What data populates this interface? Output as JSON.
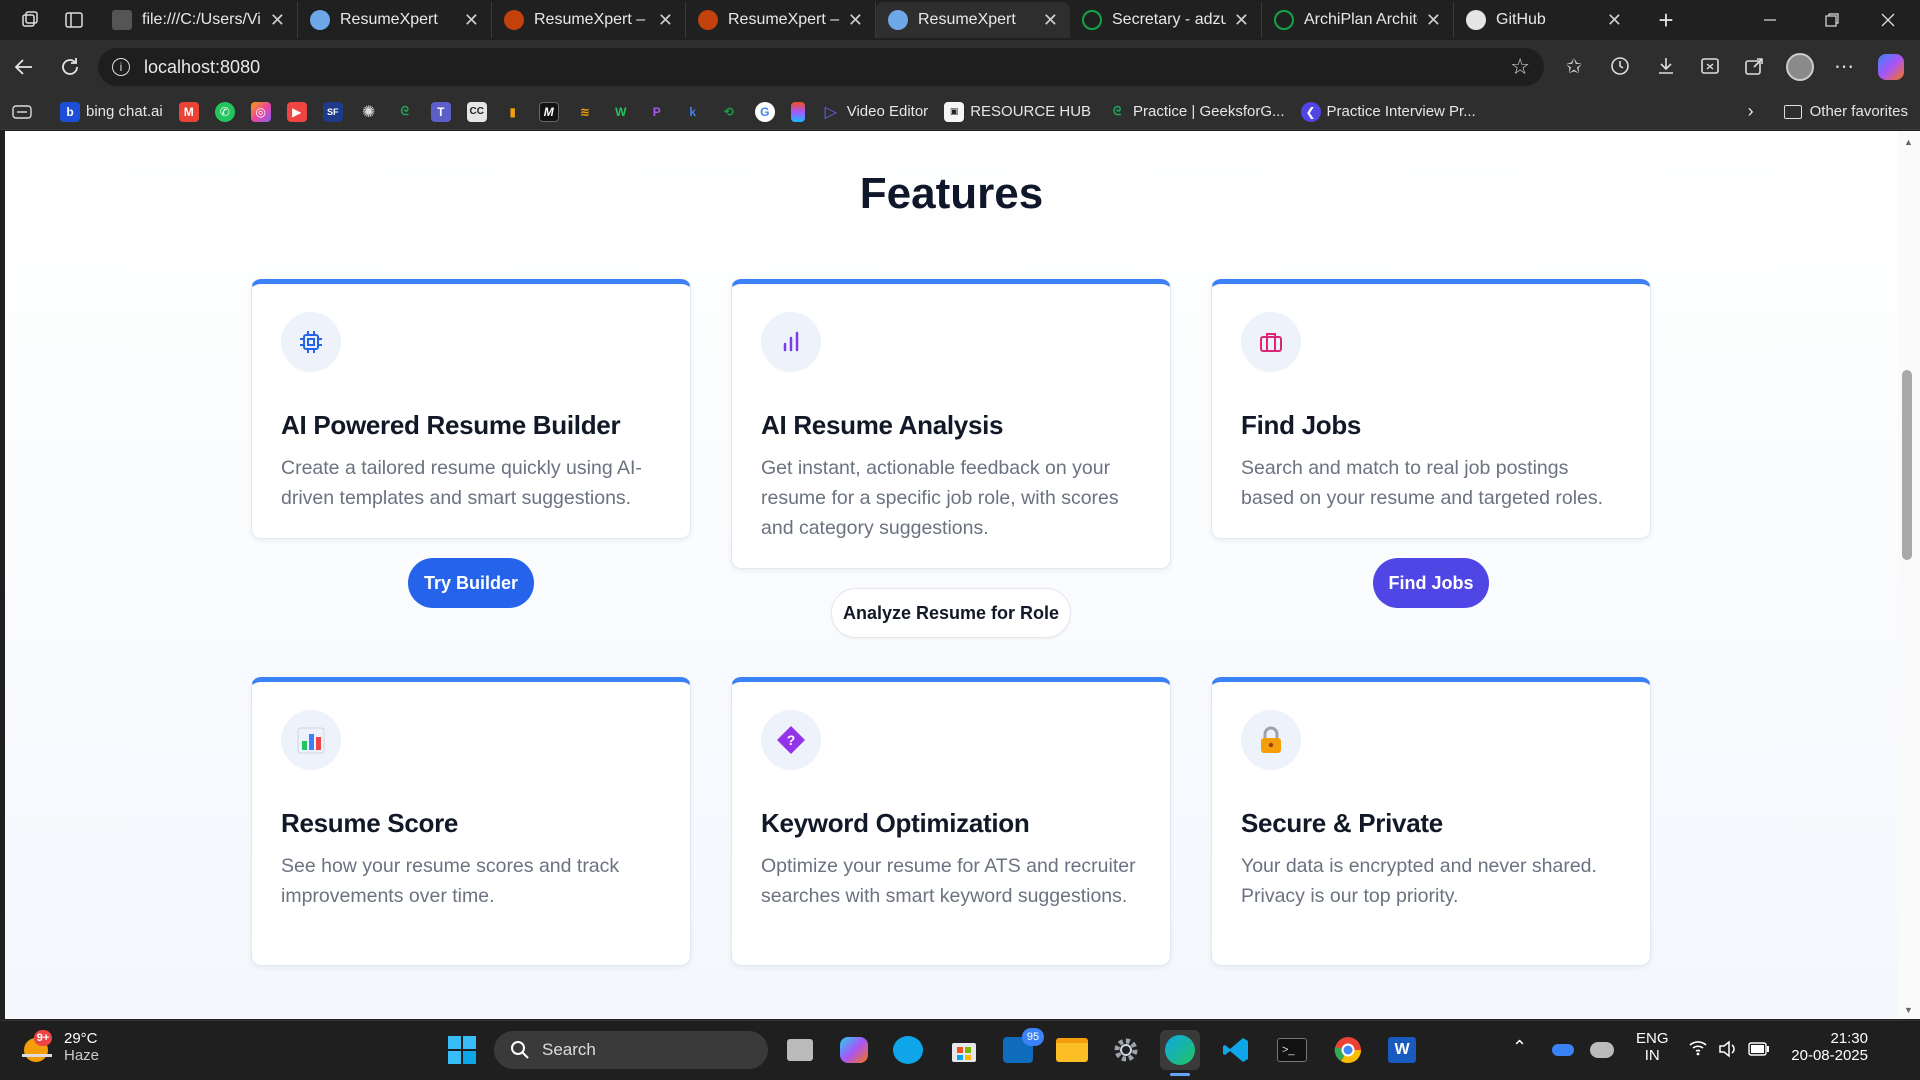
{
  "browser": {
    "tabs": [
      {
        "label": "file:///C:/Users/Vi",
        "icon": "file-icon"
      },
      {
        "label": "ResumeXpert",
        "icon": "resumexpert-favicon"
      },
      {
        "label": "ResumeXpert – Cl",
        "icon": "flame-favicon"
      },
      {
        "label": "ResumeXpert – Cl",
        "icon": "flame-favicon"
      },
      {
        "label": "ResumeXpert",
        "icon": "resumexpert-favicon",
        "active": true
      },
      {
        "label": "Secretary - adzun",
        "icon": "green-circle-favicon"
      },
      {
        "label": "ArchiPlan Archite",
        "icon": "green-circle-favicon"
      },
      {
        "label": "GitHub",
        "icon": "github-icon"
      }
    ],
    "url": "localhost:8080",
    "bookmarks": [
      {
        "label": "bing chat.ai",
        "icon": "bing-icon"
      },
      {
        "label": "",
        "icon": "gmail-icon"
      },
      {
        "label": "",
        "icon": "whatsapp-icon"
      },
      {
        "label": "",
        "icon": "instagram-icon"
      },
      {
        "label": "",
        "icon": "youtube-icon"
      },
      {
        "label": "",
        "icon": "sf-icon"
      },
      {
        "label": "",
        "icon": "openai-icon"
      },
      {
        "label": "",
        "icon": "geeksforgeeks-icon"
      },
      {
        "label": "",
        "icon": "teams-icon"
      },
      {
        "label": "",
        "icon": "cc-icon"
      },
      {
        "label": "",
        "icon": "chart-icon"
      },
      {
        "label": "",
        "icon": "medium-icon"
      },
      {
        "label": "",
        "icon": "stack-icon"
      },
      {
        "label": "",
        "icon": "w-icon"
      },
      {
        "label": "",
        "icon": "p-icon"
      },
      {
        "label": "",
        "icon": "k-icon"
      },
      {
        "label": "",
        "icon": "gfg-icon"
      },
      {
        "label": "",
        "icon": "google-icon"
      },
      {
        "label": "",
        "icon": "figma-icon"
      },
      {
        "label": "Video Editor",
        "icon": "play-icon"
      },
      {
        "label": "RESOURCE HUB",
        "icon": "notion-icon"
      },
      {
        "label": "Practice | GeeksforG...",
        "icon": "geeksforgeeks-icon"
      },
      {
        "label": "Practice Interview Pr...",
        "icon": "interview-icon"
      }
    ],
    "other_favorites": "Other favorites"
  },
  "page": {
    "title": "Features",
    "cards": [
      {
        "title": "AI Powered Resume Builder",
        "desc": "Create a tailored resume quickly using AI-driven templates and smart suggestions.",
        "icon": "cpu-chip-icon",
        "button": "Try Builder"
      },
      {
        "title": "AI Resume Analysis",
        "desc": "Get instant, actionable feedback on your resume for a specific job role, with scores and category suggestions.",
        "icon": "bar-signal-icon",
        "button": "Analyze Resume for Role"
      },
      {
        "title": "Find Jobs",
        "desc": "Search and match to real job postings based on your resume and targeted roles.",
        "icon": "briefcase-icon",
        "button": "Find Jobs"
      },
      {
        "title": "Resume Score",
        "desc": "See how your resume scores and track improvements over time.",
        "icon": "bar-chart-emoji-icon"
      },
      {
        "title": "Keyword Optimization",
        "desc": "Optimize your resume for ATS and recruiter searches with smart keyword suggestions.",
        "icon": "question-diamond-icon"
      },
      {
        "title": "Secure & Private",
        "desc": "Your data is encrypted and never shared. Privacy is our top priority.",
        "icon": "lock-icon"
      }
    ],
    "colors": {
      "card_top": "#3b82f6",
      "btn_blue": "#2563eb",
      "btn_indigo": "#4f46e5"
    }
  },
  "taskbar": {
    "weather": {
      "temp": "29°C",
      "condition": "Haze",
      "badge": "9+"
    },
    "search_placeholder": "Search",
    "outlook_badge": "95",
    "lang": "ENG",
    "region": "IN",
    "time": "21:30",
    "date": "20-08-2025"
  }
}
